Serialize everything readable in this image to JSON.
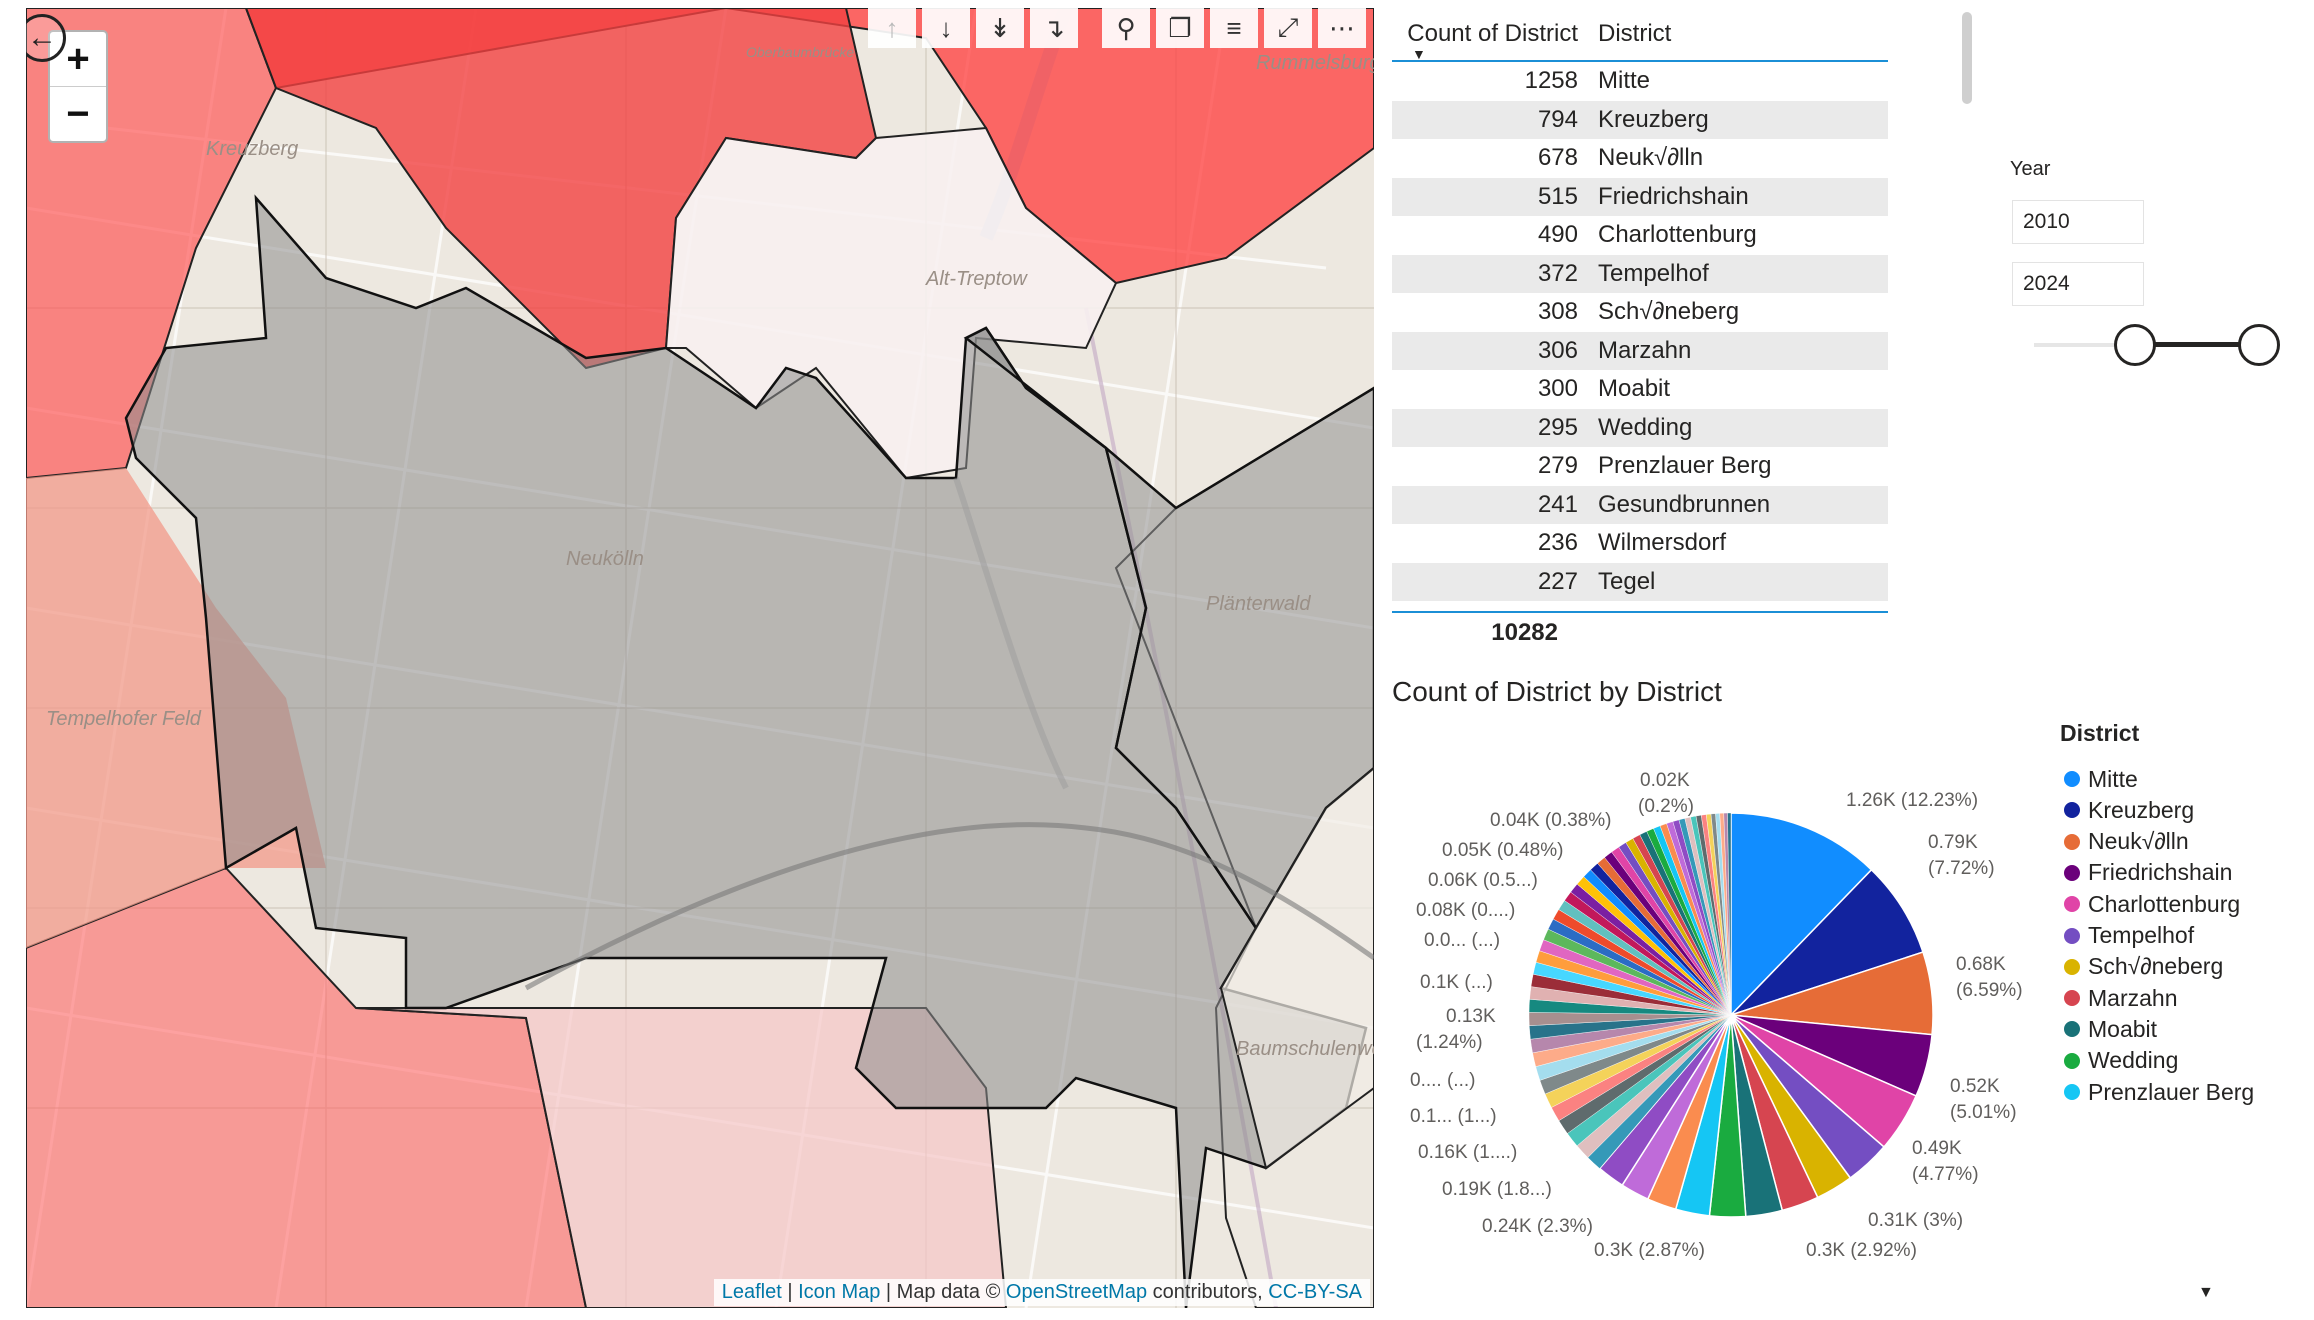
{
  "map": {
    "zoom_in": "+",
    "zoom_out": "−",
    "back_icon": "back-arrow-icon",
    "place_labels": [
      "Kreuzberg",
      "Neukölln",
      "Tempelhofer Feld",
      "Plänterwald",
      "Alt-Treptow",
      "Baumschulenweg",
      "Oberbaumbrücke",
      "Rummelsburg"
    ],
    "attribution": {
      "leaflet": "Leaflet",
      "sep1": " | ",
      "iconmap": "Icon Map",
      "sep2": " | Map data © ",
      "osm": "OpenStreetMap",
      "sep3": " contributors, ",
      "license": "CC-BY-SA"
    }
  },
  "toolbar": {
    "icons": [
      "drill-up-icon",
      "drill-down-icon",
      "expand-all-levels-icon",
      "expand-next-level-icon",
      "pin-icon",
      "copy-icon",
      "filter-icon",
      "focus-mode-icon",
      "more-options-icon"
    ]
  },
  "table": {
    "col_count": "Count of District",
    "col_district": "District",
    "rows": [
      {
        "count": "1258",
        "district": "Mitte"
      },
      {
        "count": "794",
        "district": "Kreuzberg"
      },
      {
        "count": "678",
        "district": "Neuk√∂lln"
      },
      {
        "count": "515",
        "district": "Friedrichshain"
      },
      {
        "count": "490",
        "district": "Charlottenburg"
      },
      {
        "count": "372",
        "district": "Tempelhof"
      },
      {
        "count": "308",
        "district": "Sch√∂neberg"
      },
      {
        "count": "306",
        "district": "Marzahn"
      },
      {
        "count": "300",
        "district": "Moabit"
      },
      {
        "count": "295",
        "district": "Wedding"
      },
      {
        "count": "279",
        "district": "Prenzlauer Berg"
      },
      {
        "count": "241",
        "district": "Gesundbrunnen"
      },
      {
        "count": "236",
        "district": "Wilmersdorf"
      },
      {
        "count": "227",
        "district": "Tegel"
      }
    ],
    "total": "10282"
  },
  "slicer": {
    "title": "Year",
    "from": "2010",
    "to": "2024"
  },
  "chart_data": {
    "type": "pie",
    "title": "Count of District by District",
    "legend_title": "District",
    "legend": [
      {
        "name": "Mitte",
        "color": "#118DFF"
      },
      {
        "name": "Kreuzberg",
        "color": "#12239E"
      },
      {
        "name": "Neuk√∂lln",
        "color": "#E66C37"
      },
      {
        "name": "Friedrichshain",
        "color": "#6B007B"
      },
      {
        "name": "Charlottenburg",
        "color": "#E044A7"
      },
      {
        "name": "Tempelhof",
        "color": "#744EC2"
      },
      {
        "name": "Sch√∂neberg",
        "color": "#D9B300"
      },
      {
        "name": "Marzahn",
        "color": "#D64550"
      },
      {
        "name": "Moabit",
        "color": "#197278"
      },
      {
        "name": "Wedding",
        "color": "#1AAB40"
      },
      {
        "name": "Prenzlauer Berg",
        "color": "#15C6F4"
      }
    ],
    "slices": [
      {
        "name": "Mitte",
        "value": 1258
      },
      {
        "name": "Kreuzberg",
        "value": 794
      },
      {
        "name": "Neuk√∂lln",
        "value": 678
      },
      {
        "name": "Friedrichshain",
        "value": 515
      },
      {
        "name": "Charlottenburg",
        "value": 490
      },
      {
        "name": "Tempelhof",
        "value": 372
      },
      {
        "name": "Sch√∂neberg",
        "value": 308
      },
      {
        "name": "Marzahn",
        "value": 306
      },
      {
        "name": "Moabit",
        "value": 300
      },
      {
        "name": "Wedding",
        "value": 295
      },
      {
        "name": "Prenzlauer Berg",
        "value": 279
      },
      {
        "name": "Gesundbrunnen",
        "value": 241
      },
      {
        "name": "Wilmersdorf",
        "value": 236
      },
      {
        "name": "Tegel",
        "value": 227
      }
    ],
    "other_total": 3983,
    "total": 10282,
    "data_labels": [
      {
        "text": "1.26K (12.23%)"
      },
      {
        "text": "0.79K"
      },
      {
        "text": "(7.72%)"
      },
      {
        "text": "0.68K"
      },
      {
        "text": "(6.59%)"
      },
      {
        "text": "0.52K"
      },
      {
        "text": "(5.01%)"
      },
      {
        "text": "0.49K"
      },
      {
        "text": "(4.77%)"
      },
      {
        "text": "0.31K (3%)"
      },
      {
        "text": "0.3K (2.92%)"
      },
      {
        "text": "0.3K (2.87%)"
      },
      {
        "text": "0.24K (2.3%)"
      },
      {
        "text": "0.19K (1.8...)"
      },
      {
        "text": "0.16K (1....)"
      },
      {
        "text": "0.1... (1...)"
      },
      {
        "text": "0.... (...)"
      },
      {
        "text": "0.13K"
      },
      {
        "text": "(1.24%)"
      },
      {
        "text": "0.1K (...)"
      },
      {
        "text": "0.0... (...)"
      },
      {
        "text": "0.08K (0....)"
      },
      {
        "text": "0.06K (0.5...)"
      },
      {
        "text": "0.05K (0.48%)"
      },
      {
        "text": "0.04K (0.38%)"
      },
      {
        "text": "0.02K"
      },
      {
        "text": "(0.2%)"
      }
    ]
  }
}
